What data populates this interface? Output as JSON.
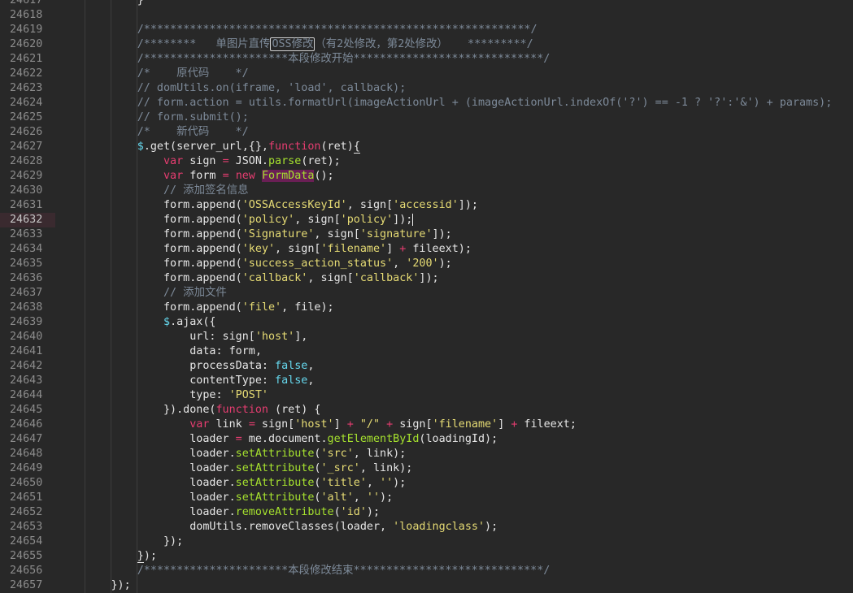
{
  "editor": {
    "active_line": "24632",
    "lines": [
      {
        "n": "24617",
        "segs": [
          {
            "t": "            }",
            "c": "op"
          }
        ]
      },
      {
        "n": "24618",
        "segs": []
      },
      {
        "n": "24619",
        "segs": [
          {
            "t": "            /***********************************************************/",
            "c": "cm"
          }
        ]
      },
      {
        "n": "24620",
        "segs": [
          {
            "t": "            /********   单图片直传",
            "c": "cm"
          },
          {
            "t": "OSS修改",
            "c": "cm box"
          },
          {
            "t": "（有2处修改，第2处修改）   *********/",
            "c": "cm"
          }
        ]
      },
      {
        "n": "24621",
        "segs": [
          {
            "t": "            /**********************本段修改开始*****************************/",
            "c": "cm"
          }
        ]
      },
      {
        "n": "24622",
        "segs": [
          {
            "t": "            /*    原代码    */",
            "c": "cm"
          }
        ]
      },
      {
        "n": "24623",
        "segs": [
          {
            "t": "            // domUtils.on(iframe, 'load', callback);",
            "c": "cm"
          }
        ]
      },
      {
        "n": "24624",
        "segs": [
          {
            "t": "            // form.action = utils.formatUrl(imageActionUrl + (imageActionUrl.indexOf('?') == -1 ? '?':'&') + params);",
            "c": "cm"
          }
        ]
      },
      {
        "n": "24625",
        "segs": [
          {
            "t": "            // form.submit();",
            "c": "cm"
          }
        ]
      },
      {
        "n": "24626",
        "segs": [
          {
            "t": "            /*    新代码    */",
            "c": "cm"
          }
        ]
      },
      {
        "n": "24627",
        "segs": [
          {
            "t": "            ",
            "c": "op"
          },
          {
            "t": "$",
            "c": "jq"
          },
          {
            "t": ".get(server_url,{},",
            "c": "op"
          },
          {
            "t": "function",
            "c": "kw"
          },
          {
            "t": "(ret)",
            "c": "op"
          },
          {
            "t": "{",
            "c": "op ul"
          }
        ]
      },
      {
        "n": "24628",
        "segs": [
          {
            "t": "                ",
            "c": "op"
          },
          {
            "t": "var",
            "c": "kw"
          },
          {
            "t": " sign ",
            "c": "op"
          },
          {
            "t": "=",
            "c": "kw"
          },
          {
            "t": " JSON.",
            "c": "op"
          },
          {
            "t": "parse",
            "c": "fn"
          },
          {
            "t": "(ret);",
            "c": "op"
          }
        ]
      },
      {
        "n": "24629",
        "segs": [
          {
            "t": "                ",
            "c": "op"
          },
          {
            "t": "var",
            "c": "kw"
          },
          {
            "t": " form ",
            "c": "op"
          },
          {
            "t": "=",
            "c": "kw"
          },
          {
            "t": " ",
            "c": "op"
          },
          {
            "t": "new",
            "c": "kw"
          },
          {
            "t": " ",
            "c": "op"
          },
          {
            "t": "FormData",
            "c": "cls"
          },
          {
            "t": "();",
            "c": "op"
          }
        ]
      },
      {
        "n": "24630",
        "segs": [
          {
            "t": "                // 添加签名信息",
            "c": "cm"
          }
        ]
      },
      {
        "n": "24631",
        "segs": [
          {
            "t": "                form.append(",
            "c": "op"
          },
          {
            "t": "'OSSAccessKeyId'",
            "c": "str"
          },
          {
            "t": ", sign[",
            "c": "op"
          },
          {
            "t": "'accessid'",
            "c": "str"
          },
          {
            "t": "]);",
            "c": "op"
          }
        ]
      },
      {
        "n": "24632",
        "segs": [
          {
            "t": "                form.append(",
            "c": "op"
          },
          {
            "t": "'policy'",
            "c": "str"
          },
          {
            "t": ", sign[",
            "c": "op"
          },
          {
            "t": "'policy'",
            "c": "str"
          },
          {
            "t": "]);",
            "c": "op"
          },
          {
            "t": "",
            "c": "cursor"
          }
        ]
      },
      {
        "n": "24633",
        "segs": [
          {
            "t": "                form.append(",
            "c": "op"
          },
          {
            "t": "'Signature'",
            "c": "str"
          },
          {
            "t": ", sign[",
            "c": "op"
          },
          {
            "t": "'signature'",
            "c": "str"
          },
          {
            "t": "]);",
            "c": "op"
          }
        ]
      },
      {
        "n": "24634",
        "segs": [
          {
            "t": "                form.append(",
            "c": "op"
          },
          {
            "t": "'key'",
            "c": "str"
          },
          {
            "t": ", sign[",
            "c": "op"
          },
          {
            "t": "'filename'",
            "c": "str"
          },
          {
            "t": "] ",
            "c": "op"
          },
          {
            "t": "+",
            "c": "kw"
          },
          {
            "t": " fileext);",
            "c": "op"
          }
        ]
      },
      {
        "n": "24635",
        "segs": [
          {
            "t": "                form.append(",
            "c": "op"
          },
          {
            "t": "'success_action_status'",
            "c": "str"
          },
          {
            "t": ", ",
            "c": "op"
          },
          {
            "t": "'200'",
            "c": "str"
          },
          {
            "t": ");",
            "c": "op"
          }
        ]
      },
      {
        "n": "24636",
        "segs": [
          {
            "t": "                form.append(",
            "c": "op"
          },
          {
            "t": "'callback'",
            "c": "str"
          },
          {
            "t": ", sign[",
            "c": "op"
          },
          {
            "t": "'callback'",
            "c": "str"
          },
          {
            "t": "]);",
            "c": "op"
          }
        ]
      },
      {
        "n": "24637",
        "segs": [
          {
            "t": "                // 添加文件",
            "c": "cm"
          }
        ]
      },
      {
        "n": "24638",
        "segs": [
          {
            "t": "                form.append(",
            "c": "op"
          },
          {
            "t": "'file'",
            "c": "str"
          },
          {
            "t": ", file);",
            "c": "op"
          }
        ]
      },
      {
        "n": "24639",
        "segs": [
          {
            "t": "                ",
            "c": "op"
          },
          {
            "t": "$",
            "c": "jq"
          },
          {
            "t": ".ajax({",
            "c": "op"
          }
        ]
      },
      {
        "n": "24640",
        "segs": [
          {
            "t": "                    url: sign[",
            "c": "op"
          },
          {
            "t": "'host'",
            "c": "str"
          },
          {
            "t": "],",
            "c": "op"
          }
        ]
      },
      {
        "n": "24641",
        "segs": [
          {
            "t": "                    data: form,",
            "c": "op"
          }
        ]
      },
      {
        "n": "24642",
        "segs": [
          {
            "t": "                    processData: ",
            "c": "op"
          },
          {
            "t": "false",
            "c": "bool"
          },
          {
            "t": ",",
            "c": "op"
          }
        ]
      },
      {
        "n": "24643",
        "segs": [
          {
            "t": "                    contentType: ",
            "c": "op"
          },
          {
            "t": "false",
            "c": "bool"
          },
          {
            "t": ",",
            "c": "op"
          }
        ]
      },
      {
        "n": "24644",
        "segs": [
          {
            "t": "                    type: ",
            "c": "op"
          },
          {
            "t": "'POST'",
            "c": "str"
          }
        ]
      },
      {
        "n": "24645",
        "segs": [
          {
            "t": "                }).done(",
            "c": "op"
          },
          {
            "t": "function",
            "c": "kw"
          },
          {
            "t": " (ret) {",
            "c": "op"
          }
        ]
      },
      {
        "n": "24646",
        "segs": [
          {
            "t": "                    ",
            "c": "op"
          },
          {
            "t": "var",
            "c": "kw"
          },
          {
            "t": " link ",
            "c": "op"
          },
          {
            "t": "=",
            "c": "kw"
          },
          {
            "t": " sign[",
            "c": "op"
          },
          {
            "t": "'host'",
            "c": "str"
          },
          {
            "t": "] ",
            "c": "op"
          },
          {
            "t": "+",
            "c": "kw"
          },
          {
            "t": " ",
            "c": "op"
          },
          {
            "t": "\"/\"",
            "c": "str"
          },
          {
            "t": " ",
            "c": "op"
          },
          {
            "t": "+",
            "c": "kw"
          },
          {
            "t": " sign[",
            "c": "op"
          },
          {
            "t": "'filename'",
            "c": "str"
          },
          {
            "t": "] ",
            "c": "op"
          },
          {
            "t": "+",
            "c": "kw"
          },
          {
            "t": " fileext;",
            "c": "op"
          }
        ]
      },
      {
        "n": "24647",
        "segs": [
          {
            "t": "                    loader ",
            "c": "op"
          },
          {
            "t": "=",
            "c": "kw"
          },
          {
            "t": " me.document.",
            "c": "op"
          },
          {
            "t": "getElementById",
            "c": "fn"
          },
          {
            "t": "(loadingId);",
            "c": "op"
          }
        ]
      },
      {
        "n": "24648",
        "segs": [
          {
            "t": "                    loader.",
            "c": "op"
          },
          {
            "t": "setAttribute",
            "c": "fn"
          },
          {
            "t": "(",
            "c": "op"
          },
          {
            "t": "'src'",
            "c": "str"
          },
          {
            "t": ", link);",
            "c": "op"
          }
        ]
      },
      {
        "n": "24649",
        "segs": [
          {
            "t": "                    loader.",
            "c": "op"
          },
          {
            "t": "setAttribute",
            "c": "fn"
          },
          {
            "t": "(",
            "c": "op"
          },
          {
            "t": "'_src'",
            "c": "str"
          },
          {
            "t": ", link);",
            "c": "op"
          }
        ]
      },
      {
        "n": "24650",
        "segs": [
          {
            "t": "                    loader.",
            "c": "op"
          },
          {
            "t": "setAttribute",
            "c": "fn"
          },
          {
            "t": "(",
            "c": "op"
          },
          {
            "t": "'title'",
            "c": "str"
          },
          {
            "t": ", ",
            "c": "op"
          },
          {
            "t": "''",
            "c": "str"
          },
          {
            "t": ");",
            "c": "op"
          }
        ]
      },
      {
        "n": "24651",
        "segs": [
          {
            "t": "                    loader.",
            "c": "op"
          },
          {
            "t": "setAttribute",
            "c": "fn"
          },
          {
            "t": "(",
            "c": "op"
          },
          {
            "t": "'alt'",
            "c": "str"
          },
          {
            "t": ", ",
            "c": "op"
          },
          {
            "t": "''",
            "c": "str"
          },
          {
            "t": ");",
            "c": "op"
          }
        ]
      },
      {
        "n": "24652",
        "segs": [
          {
            "t": "                    loader.",
            "c": "op"
          },
          {
            "t": "removeAttribute",
            "c": "fn"
          },
          {
            "t": "(",
            "c": "op"
          },
          {
            "t": "'id'",
            "c": "str"
          },
          {
            "t": ");",
            "c": "op"
          }
        ]
      },
      {
        "n": "24653",
        "segs": [
          {
            "t": "                    domUtils.removeClasses(loader, ",
            "c": "op"
          },
          {
            "t": "'loadingclass'",
            "c": "str"
          },
          {
            "t": ");",
            "c": "op"
          }
        ]
      },
      {
        "n": "24654",
        "segs": [
          {
            "t": "                });",
            "c": "op"
          }
        ]
      },
      {
        "n": "24655",
        "segs": [
          {
            "t": "            ",
            "c": "op"
          },
          {
            "t": "}",
            "c": "op ul"
          },
          {
            "t": ");",
            "c": "op"
          }
        ]
      },
      {
        "n": "24656",
        "segs": [
          {
            "t": "            /**********************本段修改结束*****************************/",
            "c": "cm"
          }
        ]
      },
      {
        "n": "24657",
        "segs": [
          {
            "t": "        });",
            "c": "op"
          }
        ]
      }
    ]
  }
}
